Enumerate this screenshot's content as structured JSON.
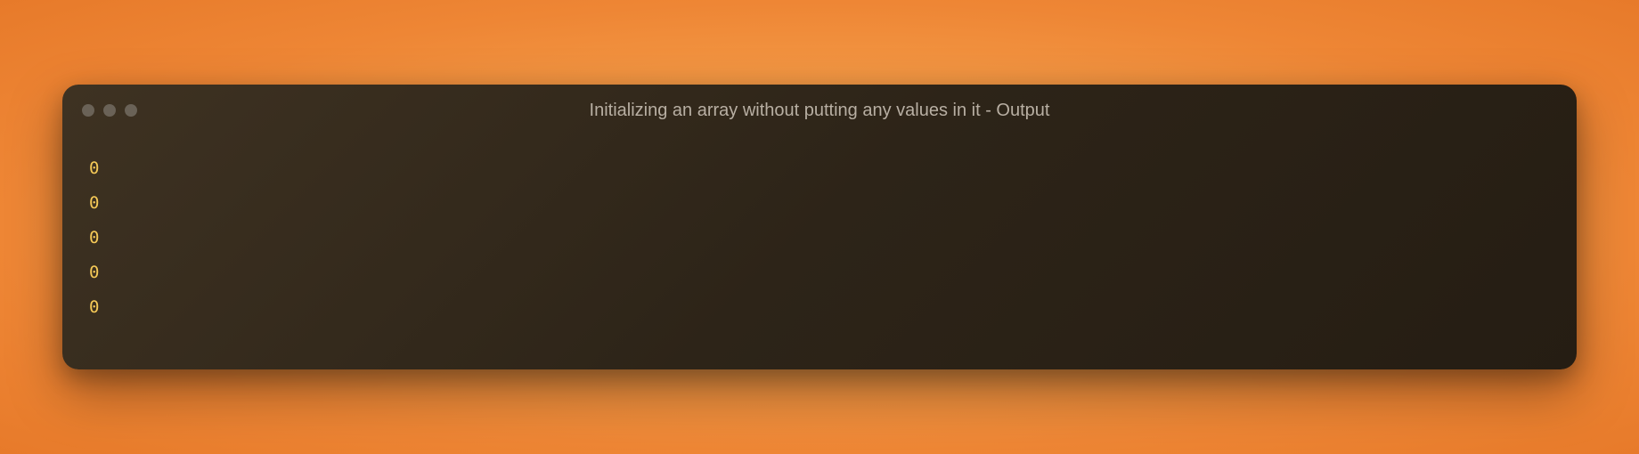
{
  "window": {
    "title": "Initializing an array without putting any values in it - Output"
  },
  "output": {
    "lines": [
      "0",
      "0",
      "0",
      "0",
      "0"
    ]
  }
}
